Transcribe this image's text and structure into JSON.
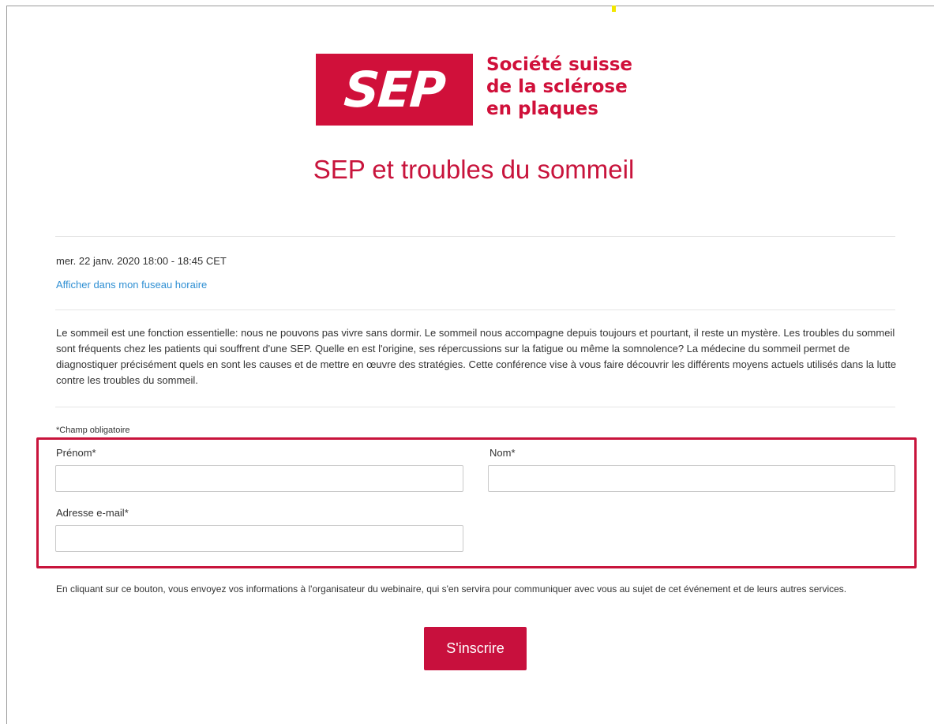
{
  "logo": {
    "mark": "SEP",
    "lines": [
      "Société suisse",
      "de la sclérose",
      "en plaques"
    ]
  },
  "event": {
    "title": "SEP et troubles du sommeil",
    "datetime": "mer. 22 janv. 2020 18:00 - 18:45 CET",
    "timezone_link": "Afficher dans mon fuseau horaire",
    "description": "Le sommeil est une fonction essentielle: nous ne pouvons pas vivre sans dormir. Le sommeil nous accompagne depuis toujours et pourtant, il reste un mystère. Les troubles du sommeil sont fréquents chez les patients qui souffrent d'une SEP. Quelle en est l'origine, ses répercussions sur la fatigue ou même la somnolence? La médecine du sommeil permet de diagnostiquer précisément quels en sont les causes et de mettre en œuvre des stratégies. Cette conférence vise à vous faire découvrir les différents moyens actuels utilisés dans la lutte contre les troubles du sommeil."
  },
  "form": {
    "required_note": "*Champ obligatoire",
    "first_name_label": "Prénom*",
    "first_name_value": "",
    "last_name_label": "Nom*",
    "last_name_value": "",
    "email_label": "Adresse e-mail*",
    "email_value": "",
    "consent_text": "En cliquant sur ce bouton, vous envoyez vos informations à l'organisateur du webinaire, qui s'en servira pour communiquer avec vous au sujet de cet événement et de leurs autres services.",
    "submit_label": "S'inscrire"
  },
  "colors": {
    "brand": "#d0103a",
    "link": "#2f8fd3",
    "highlight_border": "#c8143c"
  }
}
